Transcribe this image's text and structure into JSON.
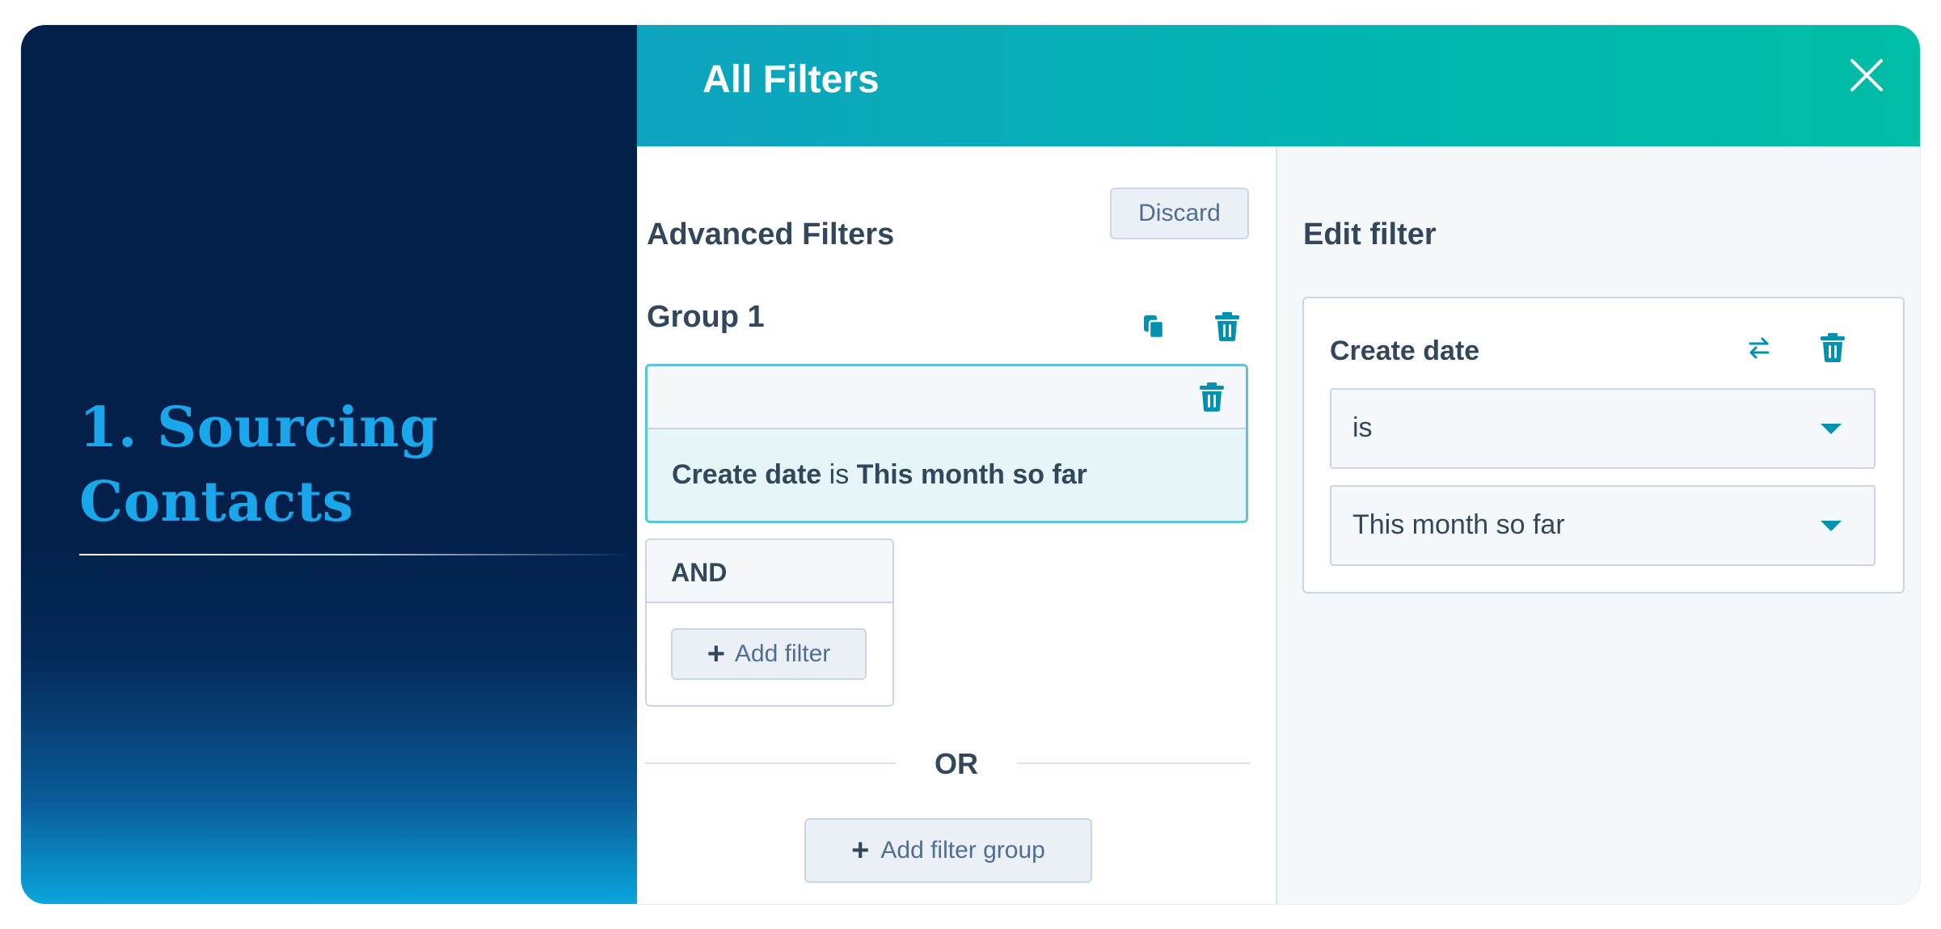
{
  "hero": {
    "title_line1": "1. Sourcing",
    "title_line2": "Contacts"
  },
  "modal": {
    "title": "All Filters",
    "close_icon": "close-icon"
  },
  "advanced": {
    "title": "Advanced Filters",
    "discard_label": "Discard",
    "group": {
      "title": "Group 1",
      "filter": {
        "property": "Create date",
        "operator": "is",
        "value": "This month so far"
      },
      "and_label": "AND",
      "add_filter_label": "Add filter"
    },
    "or_label": "OR",
    "add_group_label": "Add filter group"
  },
  "edit": {
    "title": "Edit filter",
    "property": "Create date",
    "operator_value": "is",
    "date_value": "This month so far"
  },
  "colors": {
    "accent": "#0091ae",
    "header_start": "#0ea3bf",
    "header_end": "#00bda5",
    "hero_bg": "#03204a",
    "hero_title": "#1aa6ea"
  }
}
